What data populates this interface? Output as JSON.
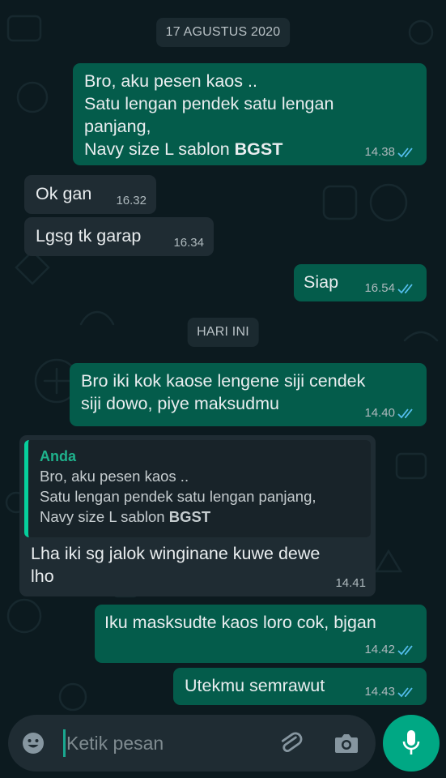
{
  "colors": {
    "background": "#0c1a1f",
    "outgoing_bubble": "#045c4b",
    "incoming_bubble": "#1f2c33",
    "read_tick": "#53bdeb",
    "accent": "#00a884"
  },
  "dates": {
    "first": "17 AGUSTUS 2020",
    "today": "HARI INI"
  },
  "messages": {
    "m1": {
      "lines": [
        "Bro, aku pesen kaos ..",
        "Satu lengan pendek satu lengan",
        "panjang,",
        "Navy size L sablon "
      ],
      "bold": "BGST",
      "time": "14.38",
      "status": "read"
    },
    "m2": {
      "text": "Ok gan",
      "time": "16.32"
    },
    "m3": {
      "text": "Lgsg tk garap",
      "time": "16.34"
    },
    "m4": {
      "text": "Siap",
      "time": "16.54",
      "status": "read"
    },
    "m5": {
      "lines": [
        "Bro iki kok kaose lengene siji cendek",
        "siji dowo, piye  maksudmu"
      ],
      "time": "14.40",
      "status": "read"
    },
    "m6": {
      "quote": {
        "author": "Anda",
        "lines": [
          "Bro, aku pesen kaos ..",
          "Satu lengan pendek satu lengan panjang,",
          "Navy size L sablon "
        ],
        "bold": "BGST"
      },
      "lines": [
        "Lha iki sg jalok winginane kuwe dewe",
        "lho"
      ],
      "time": "14.41"
    },
    "m7": {
      "text": "Iku masksudte kaos loro cok, bjgan",
      "time": "14.42",
      "status": "read"
    },
    "m8": {
      "text": "Utekmu semrawut",
      "time": "14.43",
      "status": "read"
    }
  },
  "input": {
    "placeholder": "Ketik pesan",
    "icons": [
      "emoji-icon",
      "attach-icon",
      "camera-icon",
      "mic-icon"
    ]
  }
}
